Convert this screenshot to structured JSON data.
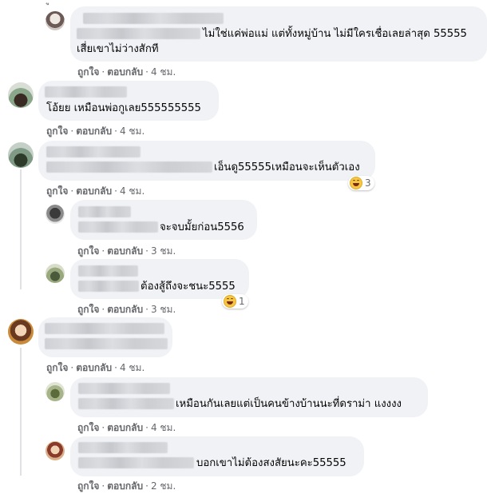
{
  "colors": {
    "bubble": "#f0f2f5",
    "action_text": "#65676b",
    "haha": "#f7c744"
  },
  "actions": {
    "like": "ถูกใจ",
    "reply": "ตอบกลับ",
    "sep": "·"
  },
  "comments": [
    {
      "text_line1": "ไม่ใช่แค่พ่อแม่ แต่ทั้งหมู่บ้าน ไม่มีใครเชื่อเลยล่าสุด 55555",
      "text_line2": "เสี่ยเขาไม่ว่างสักที",
      "time": "4 ชม."
    },
    {
      "text": "โอ้ยย เหมือนพ่อกูเลย555555555",
      "time": "4 ชม."
    },
    {
      "text": "เอ็นดู55555เหมือนจะเห็นตัวเอง",
      "time": "4 ชม.",
      "reaction": {
        "icon": "haha-icon",
        "count": "3"
      }
    },
    {
      "text": "จะจบมั้ยก่อน5556",
      "time": "3 ชม."
    },
    {
      "text": "ต้องสู้ถึงจะชนะ5555",
      "time": "3 ชม.",
      "reaction": {
        "icon": "haha-icon",
        "count": "1"
      }
    },
    {
      "text": "",
      "time": "4 ชม."
    },
    {
      "text": "เหมือนกันเลยแต่เป็นคนข้างบ้านนะที่ดราม่า แงงงง",
      "time": "4 ชม."
    },
    {
      "text": "บอกเขาไม่ต้องสงสัยนะคะ55555",
      "time": "2 ชม."
    }
  ]
}
